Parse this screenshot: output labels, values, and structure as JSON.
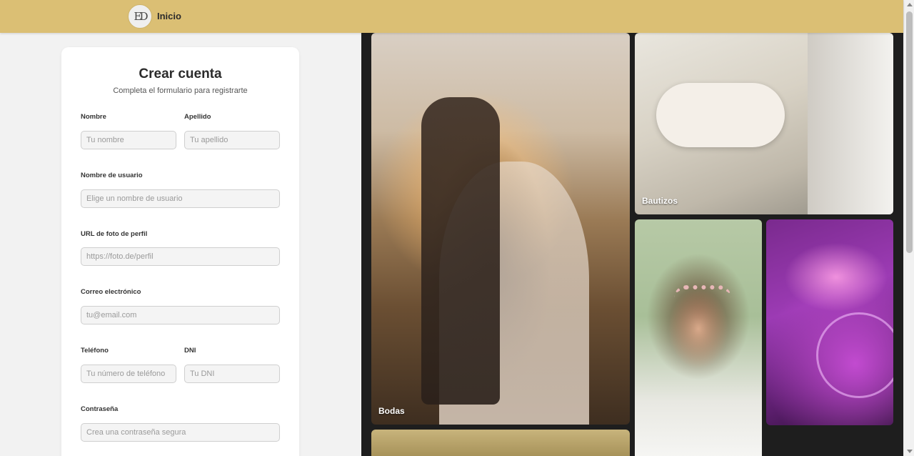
{
  "navbar": {
    "logo_text": "ED",
    "home_label": "Inicio"
  },
  "form": {
    "title": "Crear cuenta",
    "subtitle": "Completa el formulario para registrarte",
    "fields": {
      "first_name": {
        "label": "Nombre",
        "placeholder": "Tu nombre"
      },
      "last_name": {
        "label": "Apellido",
        "placeholder": "Tu apellido"
      },
      "username": {
        "label": "Nombre de usuario",
        "placeholder": "Elige un nombre de usuario"
      },
      "photo_url": {
        "label": "URL de foto de perfil",
        "placeholder": "https://foto.de/perfil"
      },
      "email": {
        "label": "Correo electrónico",
        "placeholder": "tu@email.com"
      },
      "phone": {
        "label": "Teléfono",
        "placeholder": "Tu número de teléfono"
      },
      "dni": {
        "label": "DNI",
        "placeholder": "Tu DNI"
      },
      "password": {
        "label": "Contraseña",
        "placeholder": "Crea una contraseña segura"
      }
    }
  },
  "gallery": {
    "tiles": [
      {
        "caption": "Bodas"
      },
      {
        "caption": "Bautizos"
      },
      {
        "caption": ""
      },
      {
        "caption": ""
      },
      {
        "caption": ""
      }
    ]
  }
}
